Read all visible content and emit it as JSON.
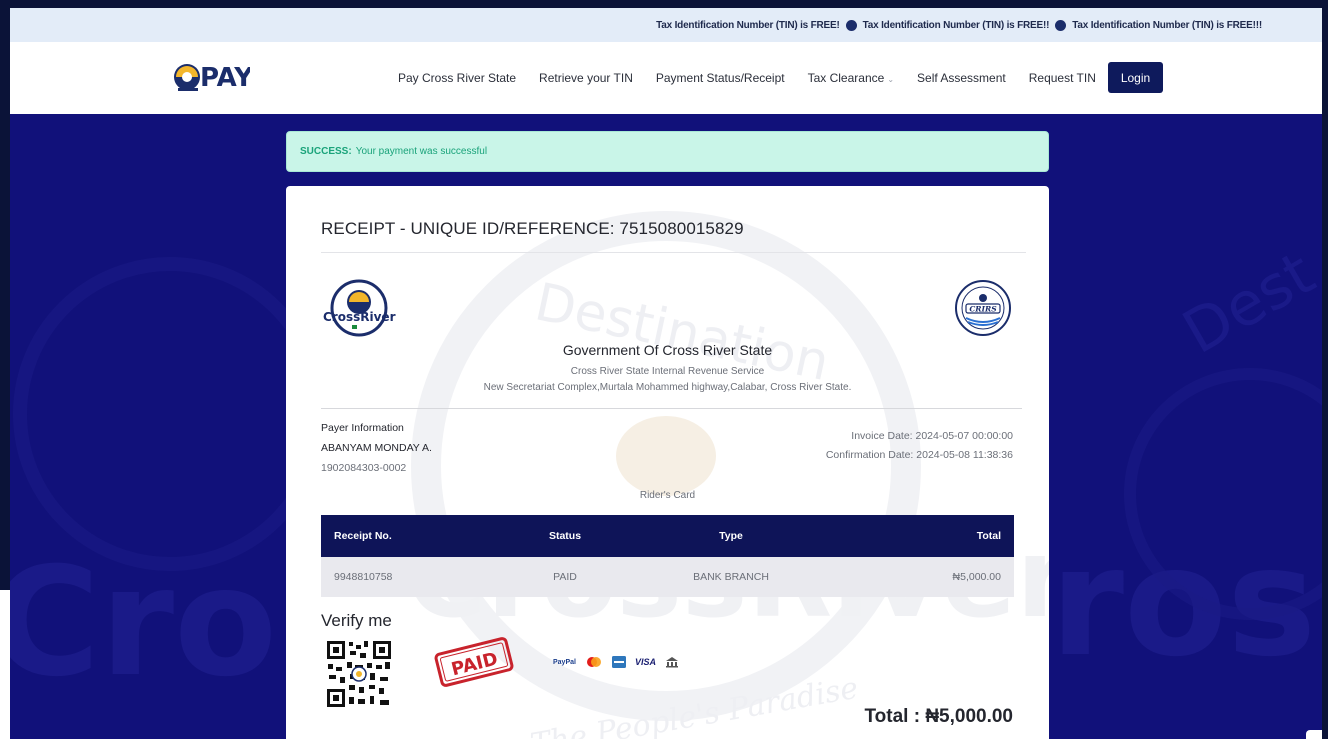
{
  "marquee": {
    "items": [
      "Tax Identification Number (TIN) is FREE!",
      "Tax Identification Number (TIN) is FREE!!",
      "Tax Identification Number (TIN) is FREE!!!"
    ]
  },
  "brand": {
    "logo_text": "PAY"
  },
  "nav": {
    "items": [
      {
        "label": "Pay Cross River State"
      },
      {
        "label": "Retrieve your TIN"
      },
      {
        "label": "Payment Status/Receipt"
      },
      {
        "label": "Tax Clearance"
      },
      {
        "label": "Self Assessment"
      },
      {
        "label": "Request TIN"
      }
    ],
    "login_label": "Login"
  },
  "alert": {
    "status": "SUCCESS:",
    "message": "Your payment was successful"
  },
  "receipt": {
    "title": "RECEIPT - UNIQUE ID/REFERENCE: 7515080015829",
    "gov_name": "Government Of Cross River State",
    "agency": "Cross River State Internal Revenue Service",
    "address": "New Secretariat Complex,Murtala Mohammed highway,Calabar, Cross River State.",
    "payer_label": "Payer Information",
    "payer_name": "ABANYAM MONDAY A.",
    "payer_id": "1902084303-0002",
    "invoice_date": "Invoice Date: 2024-05-07 00:00:00",
    "confirmation_date": "Confirmation Date: 2024-05-08 11:38:36",
    "item": "Rider's Card",
    "table": {
      "headers": [
        "Receipt No.",
        "Status",
        "Type",
        "Total"
      ],
      "row": [
        "9948810758",
        "PAID",
        "BANK BRANCH",
        "₦5,000.00"
      ]
    },
    "verify_label": "Verify me",
    "paid_stamp": "PAID",
    "total": "Total : ₦5,000.00",
    "seal_left_text": "CrossRiver",
    "seal_right_text": "CRIRS"
  },
  "payment_logos": [
    "PayPal",
    "mastercard",
    "amex",
    "VISA",
    "bank"
  ],
  "colors": {
    "hero_bg": "#11117a",
    "nav_button": "#0e1a5c",
    "table_header": "#0e1458",
    "success_bg": "#c9f5e8",
    "success_text": "#1aa37a",
    "stamp_red": "#c8232c"
  }
}
